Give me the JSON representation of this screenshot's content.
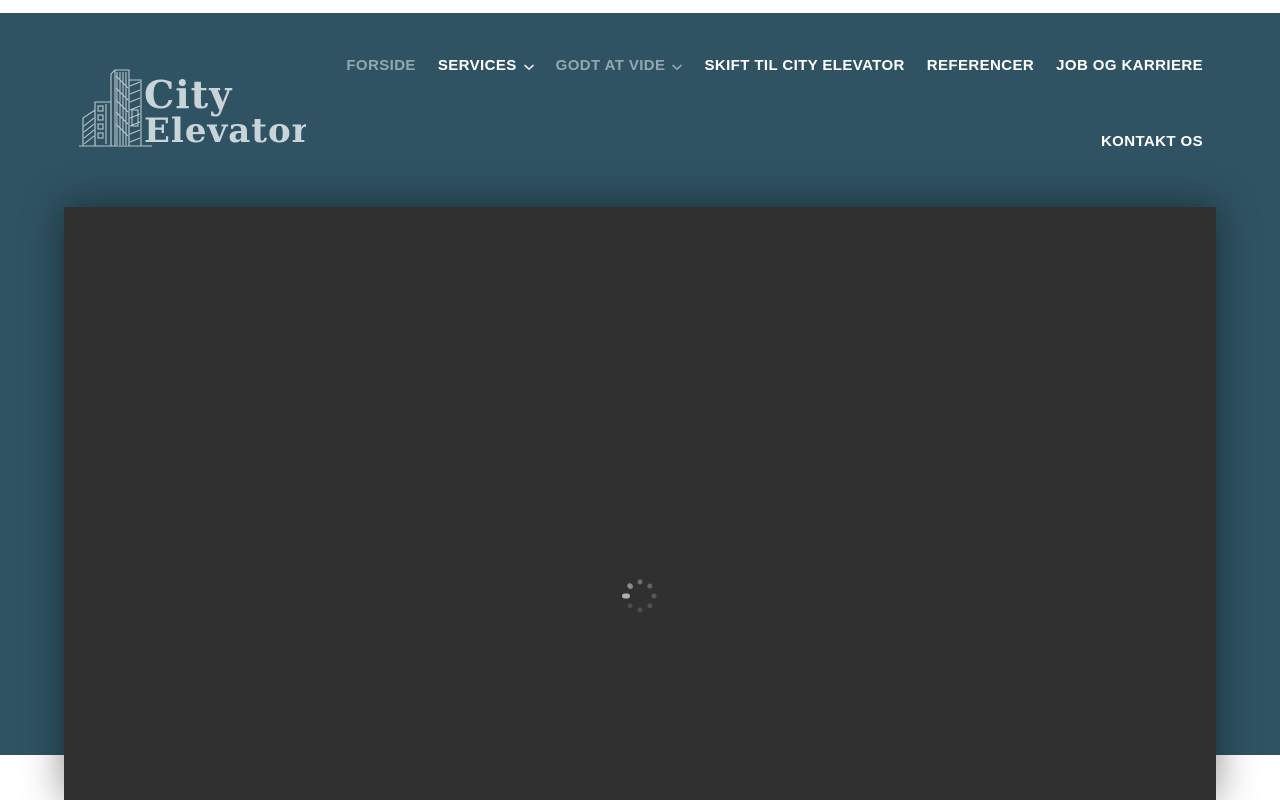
{
  "page": {
    "title": "City Elevator"
  },
  "header": {
    "logo": {
      "line1": "City",
      "line2": "Elevator",
      "alt": "City Elevator logo - sketched buildings"
    },
    "nav": {
      "items": [
        {
          "label": "FORSIDE",
          "state": "active",
          "has_dropdown": false
        },
        {
          "label": "SERVICES",
          "state": "default",
          "has_dropdown": true
        },
        {
          "label": "GODT AT VIDE",
          "state": "active",
          "has_dropdown": true
        },
        {
          "label": "SKIFT TIL CITY ELEVATOR",
          "state": "default",
          "has_dropdown": false
        },
        {
          "label": "REFERENCER",
          "state": "default",
          "has_dropdown": false
        },
        {
          "label": "JOB OG KARRIERE",
          "state": "default",
          "has_dropdown": false
        },
        {
          "label": "KONTAKT OS",
          "state": "default",
          "has_dropdown": false
        }
      ]
    }
  },
  "hero": {
    "video_player": {
      "status": "loading",
      "spinner": "loading-spinner",
      "spinner_dots": 8
    }
  },
  "colors": {
    "teal_background": "#2f5362",
    "video_background": "#303030",
    "nav_text": "#ffffff",
    "nav_text_muted": "#94a7b0",
    "logo_color": "#c9d4d9",
    "page_background": "#ffffff"
  }
}
